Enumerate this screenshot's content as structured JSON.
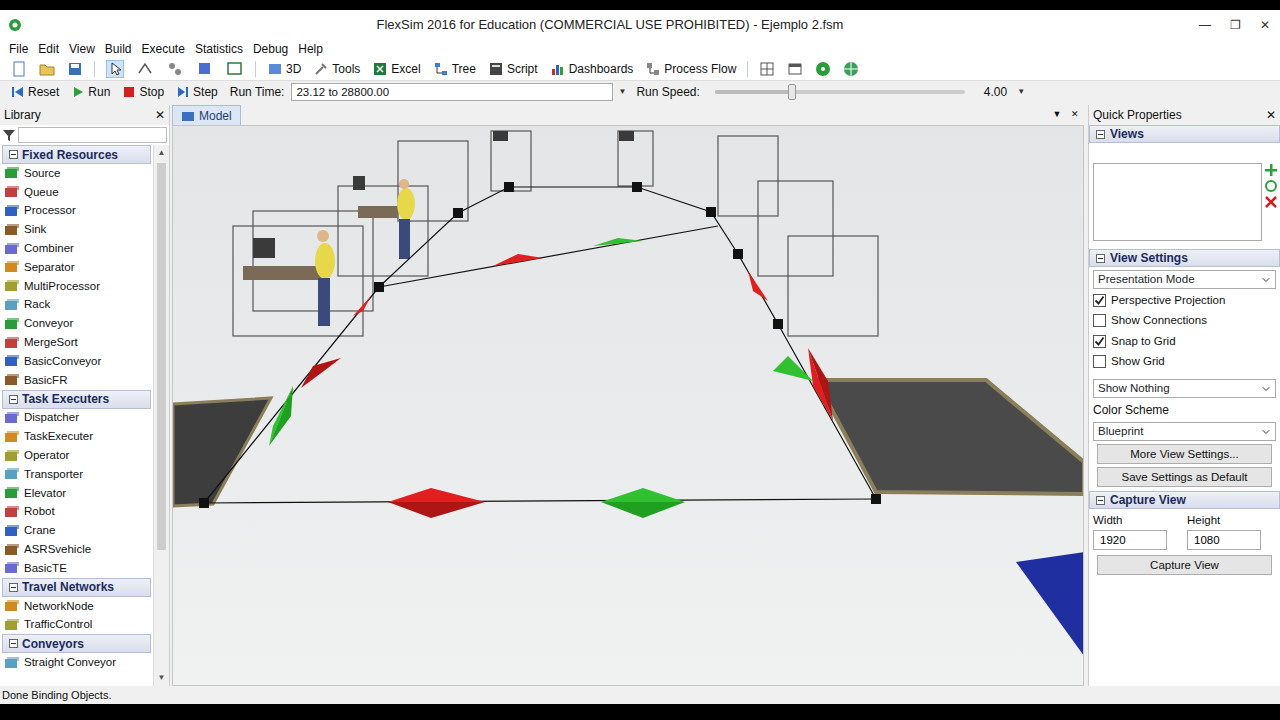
{
  "window": {
    "title": "FlexSim 2016 for Education (COMMERCIAL USE PROHIBITED) - Ejemplo 2.fsm",
    "controls": [
      "—",
      "❐",
      "✕"
    ]
  },
  "menu": [
    "File",
    "Edit",
    "View",
    "Build",
    "Execute",
    "Statistics",
    "Debug",
    "Help"
  ],
  "toolbar": [
    "3D",
    "Tools",
    "Excel",
    "Tree",
    "Script",
    "Dashboards",
    "Process Flow"
  ],
  "run_bar": {
    "buttons": [
      "Reset",
      "Run",
      "Stop",
      "Step"
    ],
    "time_label": "Run Time:",
    "time_value": "23.12 to 28800.00",
    "dropdown": "▼",
    "speed_label": "Run Speed:",
    "speed_level": 0.31,
    "speed_value": "4.00",
    "speed_dropdown": "▼"
  },
  "library": {
    "title": "Library",
    "close": "✕",
    "search": {
      "placeholder": ""
    },
    "scroll_up": "▲",
    "scroll_down": "▼",
    "groups": [
      {
        "title": "Fixed Resources",
        "expanded": true,
        "items": [
          "Source",
          "Queue",
          "Processor",
          "Sink",
          "Combiner",
          "Separator",
          "MultiProcessor",
          "Rack",
          "Conveyor",
          "MergeSort",
          "BasicConveyor",
          "BasicFR"
        ]
      },
      {
        "title": "Task Executers",
        "expanded": true,
        "items": [
          "Dispatcher",
          "TaskExecuter",
          "Operator",
          "Transporter",
          "Elevator",
          "Robot",
          "Crane",
          "ASRSvehicle",
          "BasicTE"
        ]
      },
      {
        "title": "Travel Networks",
        "expanded": true,
        "items": [
          "NetworkNode",
          "TrafficControl"
        ]
      },
      {
        "title": "Conveyors",
        "expanded": true,
        "items": [
          "Straight Conveyor"
        ]
      }
    ]
  },
  "model": {
    "tab": "Model",
    "menu": "▼",
    "close": "✕"
  },
  "quick": {
    "title": "Quick Properties",
    "close": "✕",
    "views": {
      "title": "Views"
    },
    "view_settings": {
      "title": "View Settings",
      "mode": "Presentation Mode",
      "checkboxes": [
        {
          "label": "Perspective Projection",
          "checked": true
        },
        {
          "label": "Show Connections",
          "checked": false
        },
        {
          "label": "Snap to Grid",
          "checked": true
        },
        {
          "label": "Show Grid",
          "checked": false
        }
      ],
      "show": "Show Nothing",
      "color_label": "Color Scheme",
      "color": "Blueprint",
      "buttons": [
        "More View Settings...",
        "Save Settings as Default"
      ]
    },
    "capture": {
      "title": "Capture View",
      "width_label": "Width",
      "height_label": "Height",
      "width": "1920",
      "height": "1080",
      "button": "Capture View"
    }
  },
  "status_bar": "Done Binding Objects."
}
